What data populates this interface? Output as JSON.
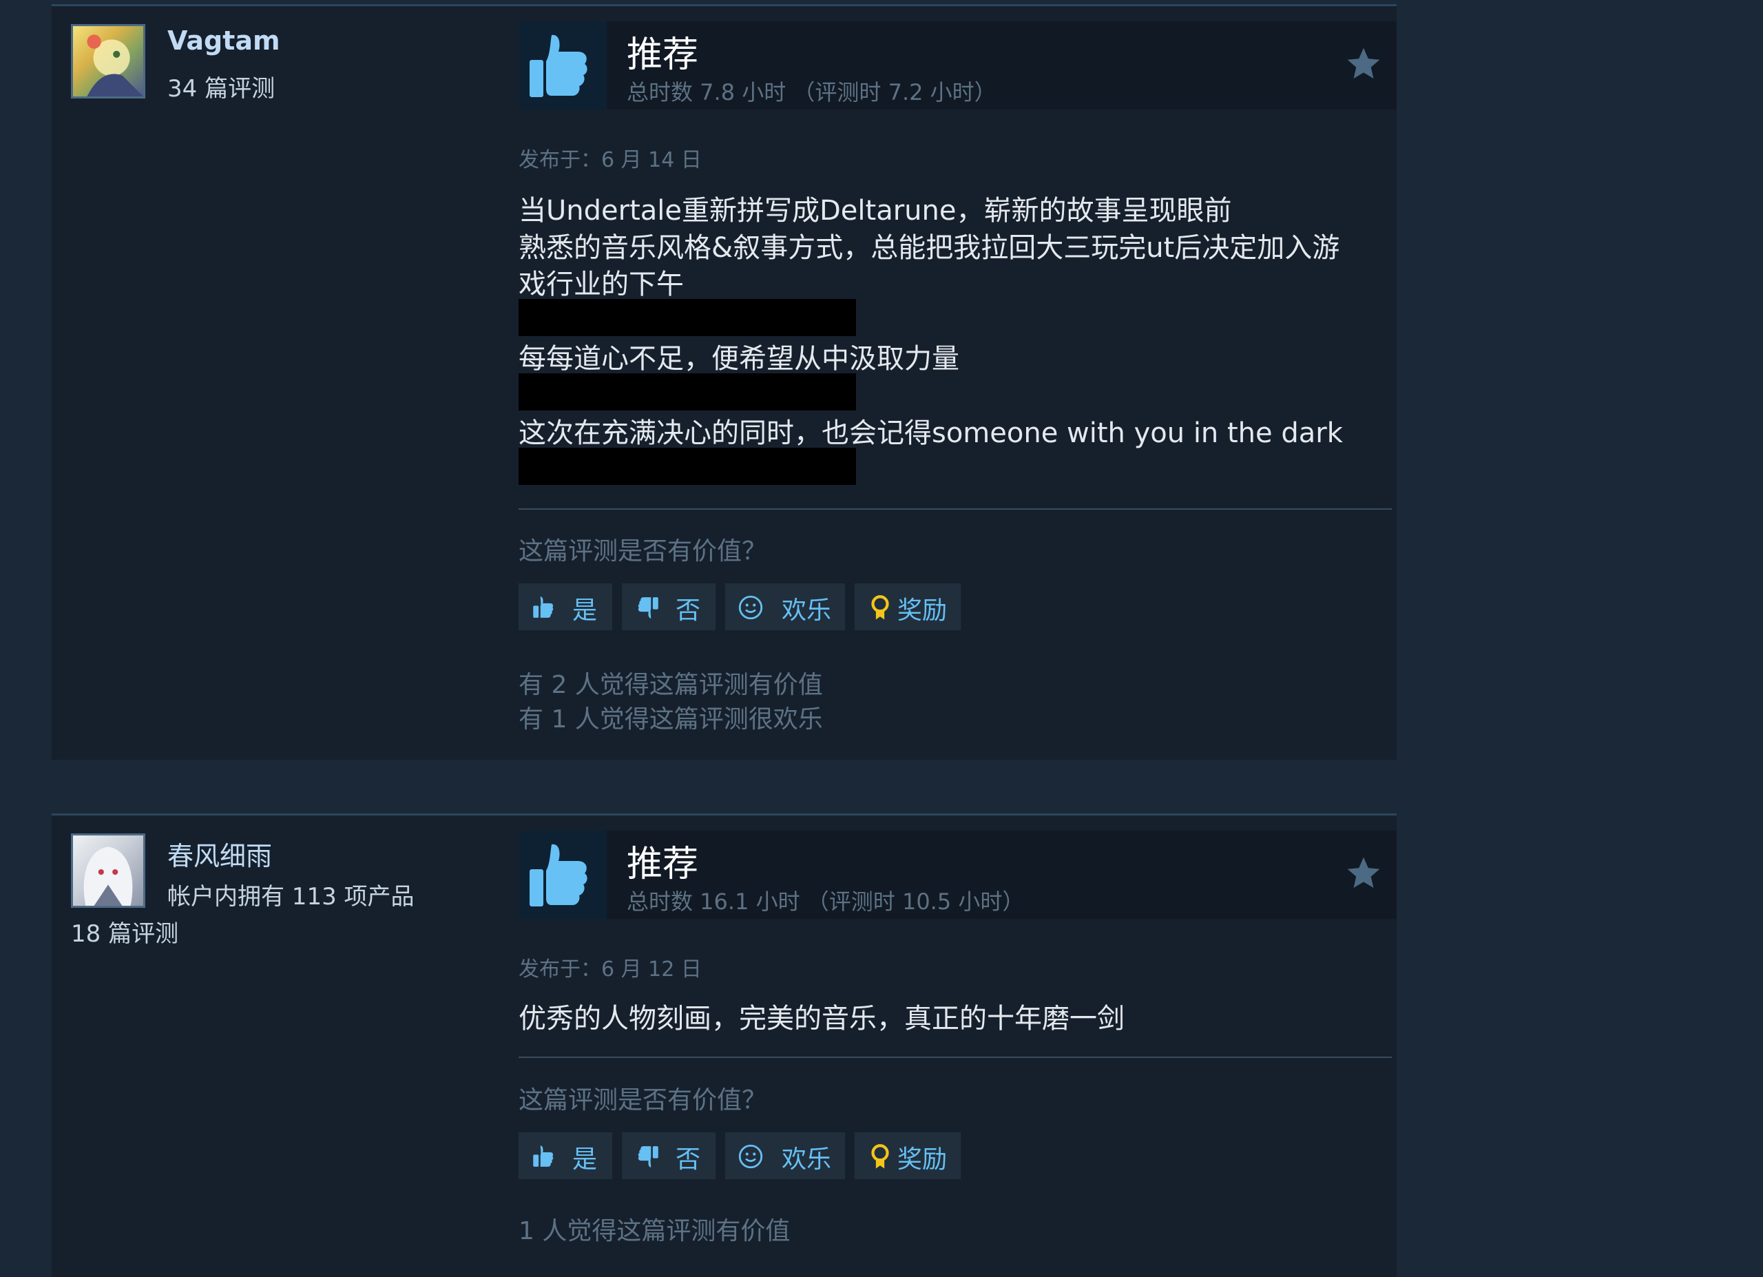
{
  "reviews": [
    {
      "author": {
        "name": "Vagtam",
        "review_count": "34 篇评测"
      },
      "verdict": {
        "title": "推荐",
        "hours": "总时数 7.8 小时",
        "hours_at_review": "（评测时 7.2 小时）"
      },
      "posted": "发布于：6 月 14 日",
      "content": [
        "当Undertale重新拼写成Deltarune，崭新的故事呈现眼前",
        "熟悉的音乐风格&叙事方式，总能把我拉回大三玩完ut后决定加入游",
        "戏行业的下午",
        "每每道心不足，便希望从中汲取力量",
        "这次在充满决心的同时，也会记得someone with you in the dark"
      ],
      "helpful_question": "这篇评测是否有价值？",
      "buttons": {
        "yes": "是",
        "no": "否",
        "funny": "欢乐",
        "award": "奖励"
      },
      "helpful_counts": [
        "有 2 人觉得这篇评测有价值",
        "有 1 人觉得这篇评测很欢乐"
      ]
    },
    {
      "author": {
        "name": "春风细雨",
        "products": "帐户内拥有 113 项产品",
        "review_count": "18 篇评测"
      },
      "verdict": {
        "title": "推荐",
        "hours": "总时数 16.1 小时",
        "hours_at_review": "（评测时 10.5 小时）"
      },
      "posted": "发布于：6 月 12 日",
      "content": [
        "优秀的人物刻画，完美的音乐，真正的十年磨一剑"
      ],
      "helpful_question": "这篇评测是否有价值？",
      "buttons": {
        "yes": "是",
        "no": "否",
        "funny": "欢乐",
        "award": "奖励"
      },
      "helpful_counts": [
        "1 人觉得这篇评测有价值"
      ]
    }
  ],
  "icons": {
    "recommend": "thumbs-up-icon",
    "favorite": "star-icon",
    "yes": "thumbs-up-icon",
    "no": "thumbs-down-icon",
    "funny": "smiley-icon",
    "award": "award-ribbon-icon"
  },
  "colors": {
    "page_bg": "#1b2838",
    "card_bg": "#16202d",
    "accent": "#66c0f4",
    "muted": "#5d7284",
    "text": "#e4e9ee"
  }
}
